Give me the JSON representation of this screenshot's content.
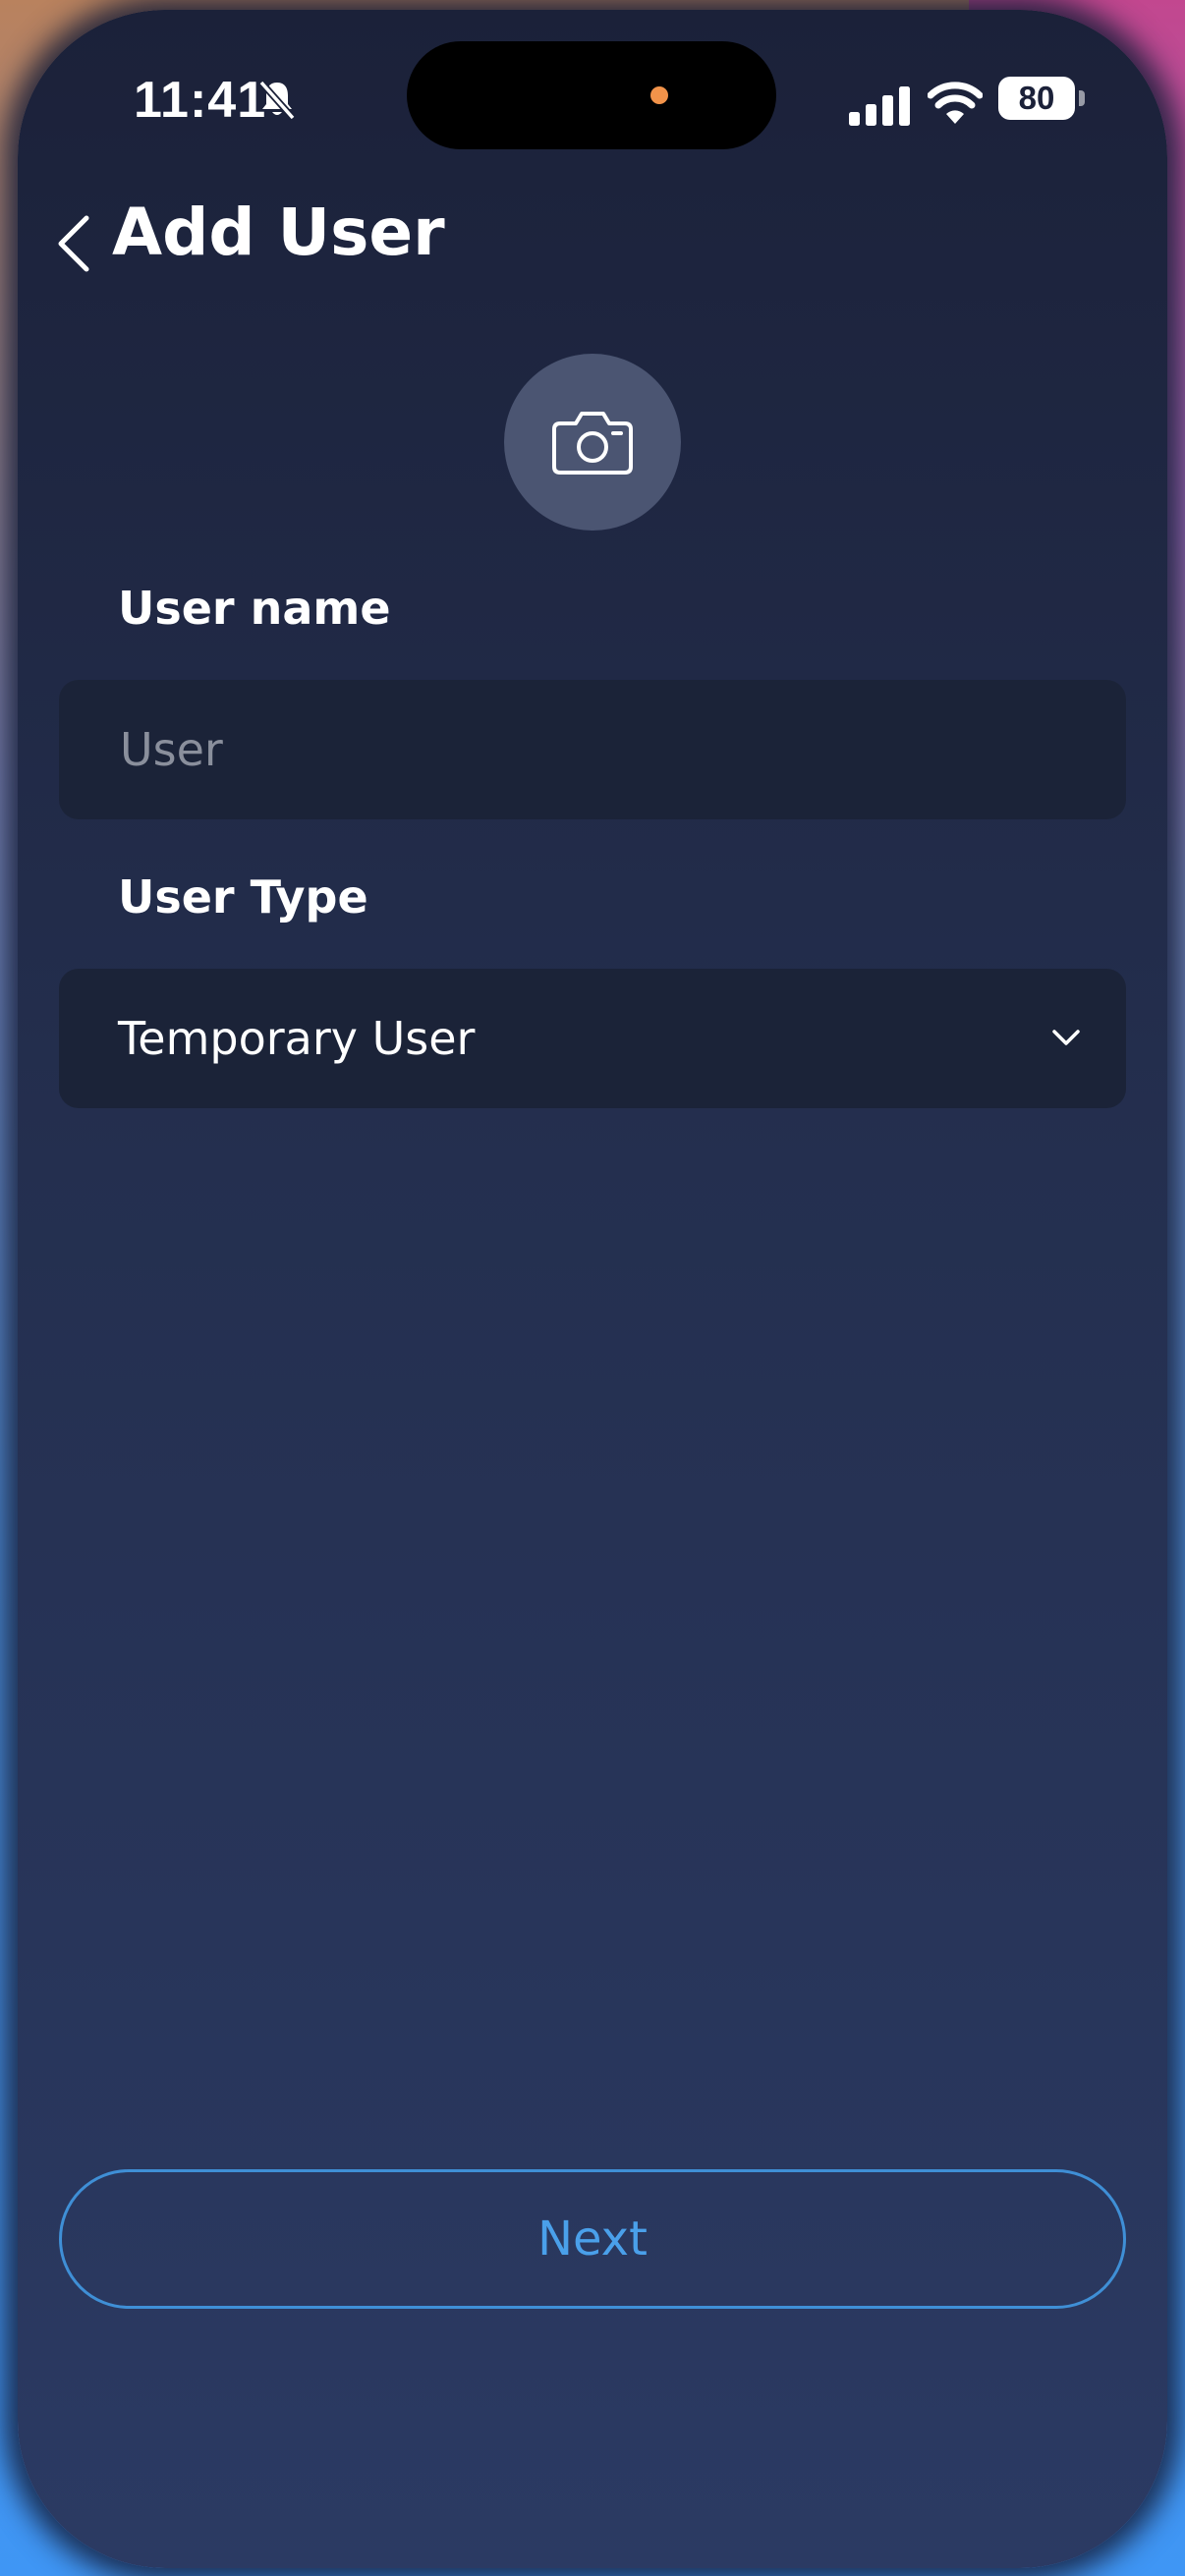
{
  "status_bar": {
    "time": "11:41",
    "battery": "80"
  },
  "header": {
    "title": "Add User"
  },
  "form": {
    "user_name_label": "User name",
    "user_name_placeholder": "User",
    "user_name_value": "",
    "user_type_label": "User Type",
    "user_type_value": "Temporary User"
  },
  "actions": {
    "next_label": "Next"
  },
  "colors": {
    "accent": "#4aa0ea",
    "background": "#1b2139",
    "field_background": "#1b2338"
  },
  "icons": {
    "back": "chevron-left-icon",
    "avatar": "camera-icon",
    "dropdown": "chevron-down-icon",
    "silent": "bell-slash-icon",
    "signal": "cellular-signal-icon",
    "wifi": "wifi-icon"
  }
}
